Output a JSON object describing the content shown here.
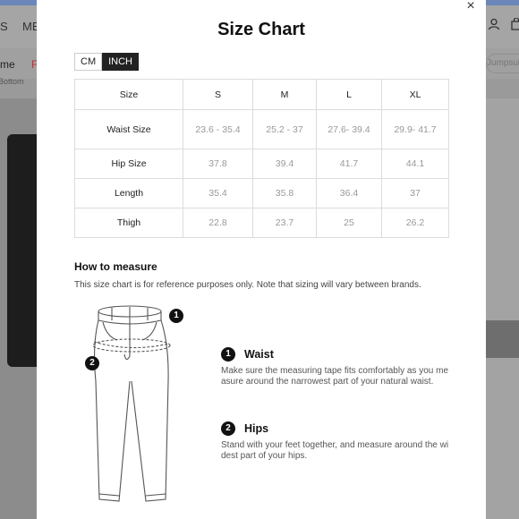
{
  "background": {
    "nav_items": [
      "S",
      "ME"
    ],
    "sub_items": [
      "me",
      "F"
    ],
    "crumb": "Bottom",
    "search_placeholder": "Jumpsuit"
  },
  "modal": {
    "close_label": "×",
    "title": "Size Chart",
    "units": {
      "cm": "CM",
      "inch": "INCH",
      "active": "INCH"
    },
    "table": {
      "headers": [
        "Size",
        "S",
        "M",
        "L",
        "XL"
      ],
      "rows": [
        [
          "Waist Size",
          "23.6 - 35.4",
          "25.2 - 37",
          "27.6- 39.4",
          "29.9- 41.7"
        ],
        [
          "Hip Size",
          "37.8",
          "39.4",
          "41.7",
          "44.1"
        ],
        [
          "Length",
          "35.4",
          "35.8",
          "36.4",
          "37"
        ],
        [
          "Thigh",
          "22.8",
          "23.7",
          "25",
          "26.2"
        ]
      ]
    },
    "how_to_measure": {
      "title": "How to measure",
      "note": "This size chart is for reference purposes only. Note that sizing will vary between brands.",
      "items": [
        {
          "num": "1",
          "name": "Waist",
          "text": "Make sure the measuring tape fits comfortably as you measure around the narrowest part of your natural waist."
        },
        {
          "num": "2",
          "name": "Hips",
          "text": "Stand with your feet together, and measure around the widest part of your hips."
        }
      ]
    }
  }
}
